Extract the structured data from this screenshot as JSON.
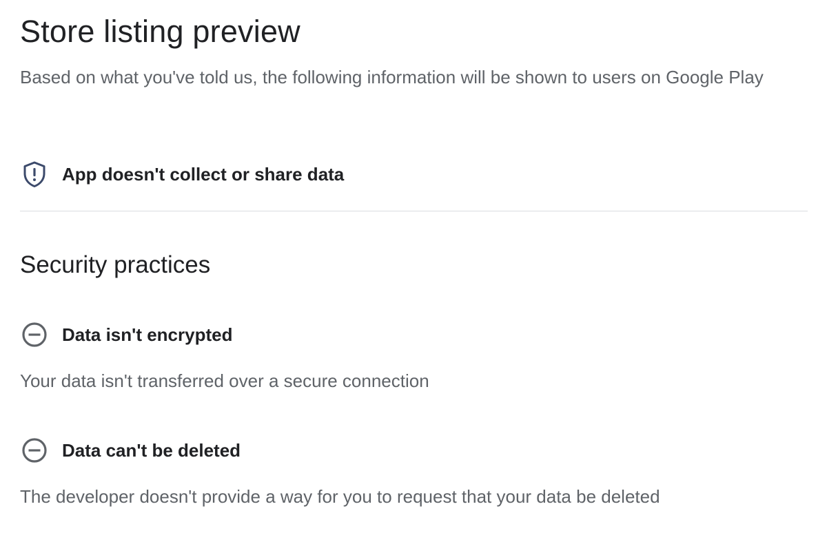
{
  "header": {
    "title": "Store listing preview",
    "subtitle": "Based on what you've told us, the following information will be shown to users on Google Play"
  },
  "data_collection": {
    "icon": "shield-exclamation-icon",
    "label": "App doesn't collect or share data",
    "icon_color": "#3c4a6b"
  },
  "security": {
    "title": "Security practices",
    "items": [
      {
        "icon": "minus-circle-icon",
        "label": "Data isn't encrypted",
        "description": "Your data isn't transferred over a secure connection"
      },
      {
        "icon": "minus-circle-icon",
        "label": "Data can't be deleted",
        "description": "The developer doesn't provide a way for you to request that your data be deleted"
      }
    ]
  },
  "colors": {
    "text_primary": "#202124",
    "text_secondary": "#5f6368",
    "divider": "#dadce0",
    "icon_gray": "#5f6368"
  }
}
